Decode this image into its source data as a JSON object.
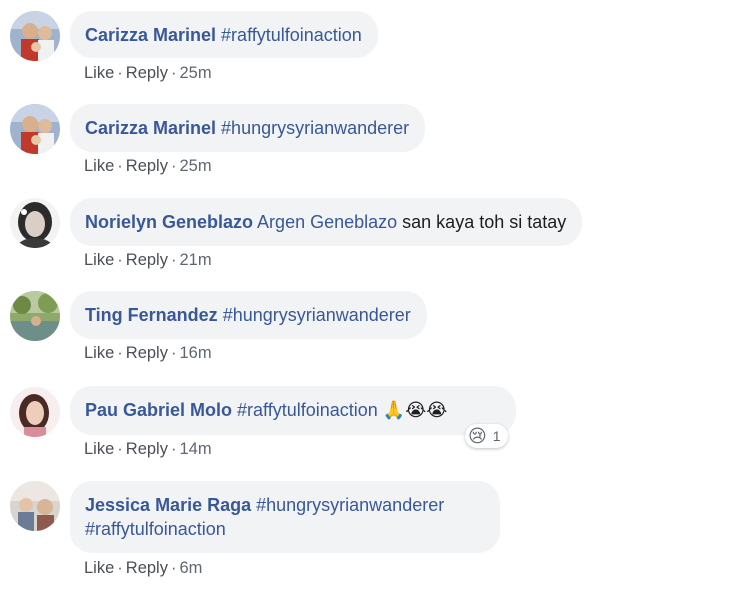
{
  "comments": [
    {
      "author": "Carizza Marinel",
      "text": " #raffytulfoinaction",
      "actions": {
        "like": "Like",
        "reply": "Reply",
        "time": "25m"
      }
    },
    {
      "author": "Carizza Marinel",
      "text": " #hungrysyrianwanderer",
      "actions": {
        "like": "Like",
        "reply": "Reply",
        "time": "25m"
      }
    },
    {
      "author": "Norielyn Geneblazo",
      "mention": " Argen Geneblazo",
      "text": " san kaya toh si tatay",
      "actions": {
        "like": "Like",
        "reply": "Reply",
        "time": "21m"
      }
    },
    {
      "author": "Ting Fernandez",
      "text": " #hungrysyrianwanderer",
      "actions": {
        "like": "Like",
        "reply": "Reply",
        "time": "16m"
      }
    },
    {
      "author": "Pau Gabriel Molo",
      "text": " #raffytulfoinaction",
      "emojis": "🙏😭😭",
      "reaction": {
        "icon": "😢",
        "count": "1"
      },
      "actions": {
        "like": "Like",
        "reply": "Reply",
        "time": "14m"
      }
    },
    {
      "author": "Jessica Marie Raga",
      "text": " #hungrysyrianwanderer",
      "text_line2": "#raffytulfoinaction",
      "actions": {
        "like": "Like",
        "reply": "Reply",
        "time": "6m"
      }
    }
  ],
  "separator": "·",
  "colors": {
    "link": "#385898",
    "bubble": "#f2f3f5",
    "meta": "#606770"
  },
  "icons": {
    "reaction": "sad-reaction-icon"
  }
}
